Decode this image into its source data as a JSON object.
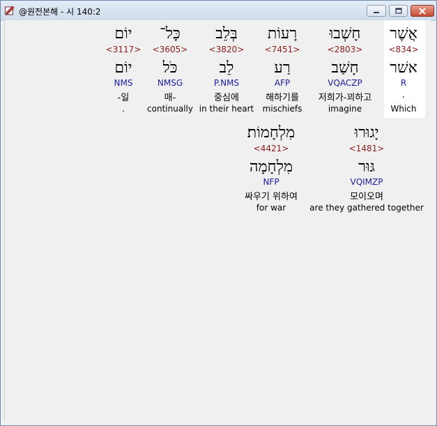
{
  "window": {
    "title": "@원전본해 - 시 140:2",
    "icon": "scroll-edit-icon",
    "controls": {
      "minimize": "minimize-icon",
      "maximize": "maximize-icon",
      "close": "close-icon"
    }
  },
  "colors": {
    "strong": "#8b1a1a",
    "parsing": "#1a1aa0",
    "highlight_bg": "#ffffff"
  },
  "words": [
    {
      "hebrew": "אֲשֶׁר",
      "strong": "<834>",
      "lemma": "אשׁר",
      "parsing": "R",
      "korean": ".",
      "english": "Which",
      "highlighted": true
    },
    {
      "hebrew": "חָשְׁבוּ",
      "strong": "<2803>",
      "lemma": "חָשַׁב",
      "parsing": "VQACZP",
      "korean": "저희가-꾀하고",
      "english": "imagine"
    },
    {
      "hebrew": "רָעוֹת",
      "strong": "<7451>",
      "lemma": "רַע",
      "parsing": "AFP",
      "korean": "해하기를",
      "english": "mischiefs"
    },
    {
      "hebrew": "בְּלֵב",
      "strong": "<3820>",
      "lemma": "לֵב",
      "parsing": "P.NMS",
      "korean": "중심에",
      "english": "in their heart"
    },
    {
      "hebrew": "כָּל־",
      "strong": "<3605>",
      "lemma": "כֹּל",
      "parsing": "NMSG",
      "korean": "매-",
      "english": "continually"
    },
    {
      "hebrew": "יוֹם",
      "strong": "<3117>",
      "lemma": "יוֹם",
      "parsing": "NMS",
      "korean": "-일",
      "english": "."
    },
    {
      "hebrew": "יָגוּרוּ",
      "strong": "<1481>",
      "lemma": "גּוּר",
      "parsing": "VQIMZP",
      "korean": "모이오며",
      "english": "are they gathered together"
    },
    {
      "hebrew": "מִלְחָמוֹת׃",
      "strong": "<4421>",
      "lemma": "מִלְחָמָה",
      "parsing": "NFP",
      "korean": "싸우기 위하여",
      "english": "for war"
    }
  ]
}
